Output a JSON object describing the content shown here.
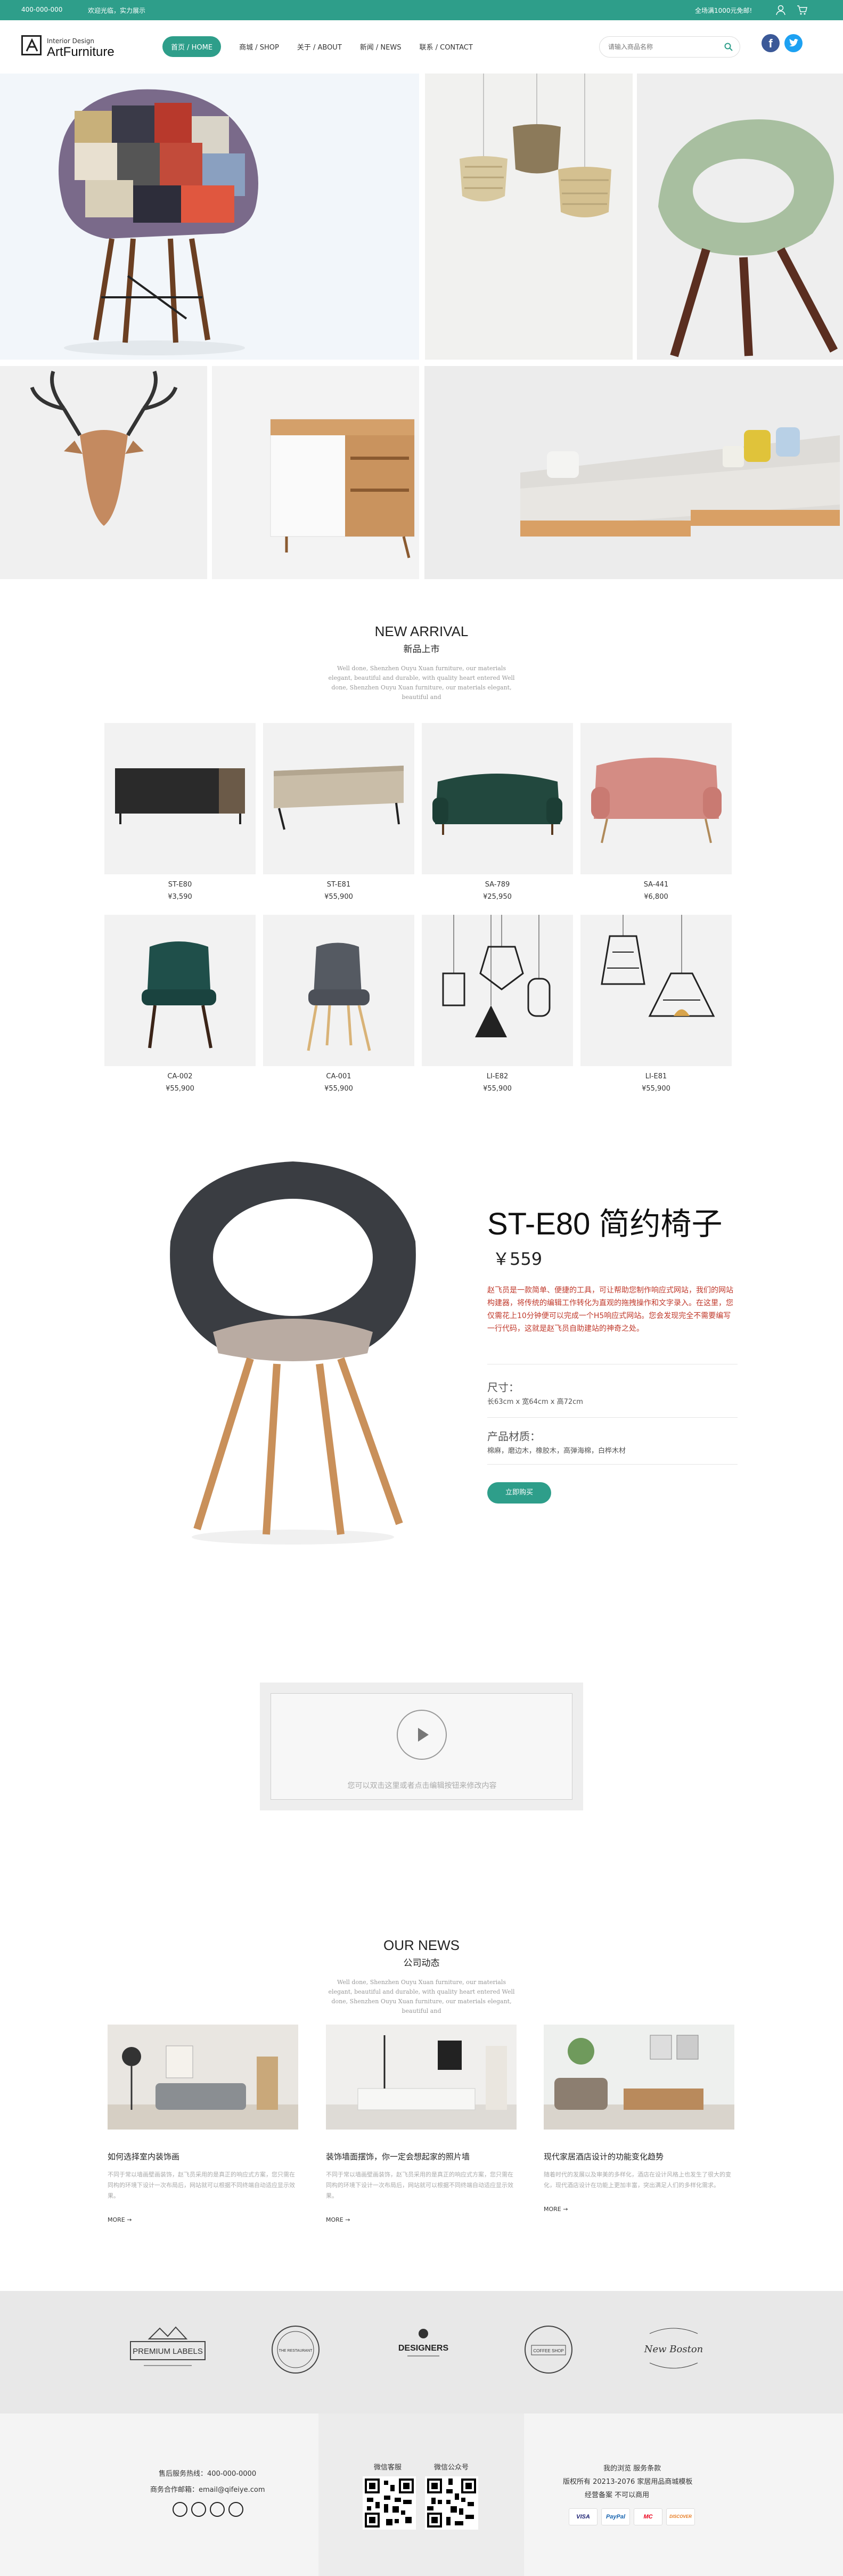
{
  "topbar": {
    "phone": "400-000-000",
    "welcome": "欢迎光临，实力展示",
    "promo": "全场满1000元免邮!"
  },
  "header": {
    "logo_sub": "Interior Design",
    "logo_main": "ArtFurniture",
    "nav": [
      "首页 / HOME",
      "商城 / SHOP",
      "关于 / ABOUT",
      "新闻 / NEWS",
      "联系 / CONTACT"
    ],
    "search_placeholder": "请输入商品名称"
  },
  "new_arrival": {
    "title": "NEW ARRIVAL",
    "subtitle": "新品上市",
    "desc": "Well done, Shenzhen Ouyu Xuan furniture, our materials elegant, beautiful and durable, with quality heart entered Well done, Shenzhen Ouyu Xuan furniture, our materials elegant, beautiful and",
    "products": [
      {
        "name": "ST-E80",
        "price": "¥3,590"
      },
      {
        "name": "ST-E81",
        "price": "¥55,900"
      },
      {
        "name": "SA-789",
        "price": "¥25,950"
      },
      {
        "name": "SA-441",
        "price": "¥6,800"
      },
      {
        "name": "CA-002",
        "price": "¥55,900"
      },
      {
        "name": "CA-001",
        "price": "¥55,900"
      },
      {
        "name": "LI-E82",
        "price": "¥55,900"
      },
      {
        "name": "LI-E81",
        "price": "¥55,900"
      }
    ]
  },
  "feature": {
    "title": "ST-E80 简约椅子",
    "price": "￥559",
    "desc": "赵飞员是一款简单、便捷的工具，可让帮助您制作响应式网站，我们的网站构建器，将传统的编辑工作转化为直观的拖拽操作和文字录入。在这里，您仅需花上10分钟便可以完成一个H5响应式网站。您会发现完全不需要编写一行代码，这就是赵飞员自助建站的神奇之处。",
    "size_label": "尺寸：",
    "size_value": "长63cm x 宽64cm x 高72cm",
    "material_label": "产品材质：",
    "material_value": "棉麻，磨边木，橡胶木，高弹海棉，白桦木材",
    "buy_label": "立即购买"
  },
  "video": {
    "text": "您可以双击这里或者点击编辑按钮来修改内容"
  },
  "news": {
    "title": "OUR NEWS",
    "subtitle": "公司动态",
    "desc": "Well done, Shenzhen Ouyu Xuan furniture, our materials elegant, beautiful and durable, with quality heart entered Well done, Shenzhen Ouyu Xuan furniture, our materials elegant, beautiful and",
    "items": [
      {
        "title": "如何选择室内装饰画",
        "desc": "不同于常以墙画壁画装饰，赵飞员采用的是真正的响应式方案，您只需在同构的环境下设计一次布局后，网站就可以根据不同终端自动适应显示效果。",
        "more": "MORE →"
      },
      {
        "title": "装饰墙面摆饰，你一定会想起家的照片墙",
        "desc": "不同于常以墙画壁画装饰，赵飞员采用的是真正的响应式方案，您只需在同构的环境下设计一次布局后，网站就可以根据不同终端自动适应显示效果。",
        "more": "MORE →"
      },
      {
        "title": "现代家居酒店设计的功能变化趋势",
        "desc": "随着时代的发展以及审美的多样化，酒店在设计风格上也发生了很大的变化，现代酒店设计在功能上更加丰富，突出满足人们的多样化需求。",
        "more": "MORE →"
      }
    ]
  },
  "brands": [
    "PREMIUM LABELS",
    "THE RESTAURANT",
    "DESIGNERS",
    "COFFEE SHOP",
    "New Boston"
  ],
  "footer": {
    "hotline": "售后服务热线：400-000-0000",
    "email": "商务合作邮箱：email@qifeiye.com",
    "wechat1": "微信客服",
    "wechat2": "微信公众号",
    "links": "我的浏览  服务条款",
    "copyright": "版权所有 20213-2076 家居用品商城模板",
    "icp": "经营备案 不可以商用",
    "payments": [
      "VISA",
      "PayPal",
      "MC",
      "DISCOVER"
    ]
  }
}
